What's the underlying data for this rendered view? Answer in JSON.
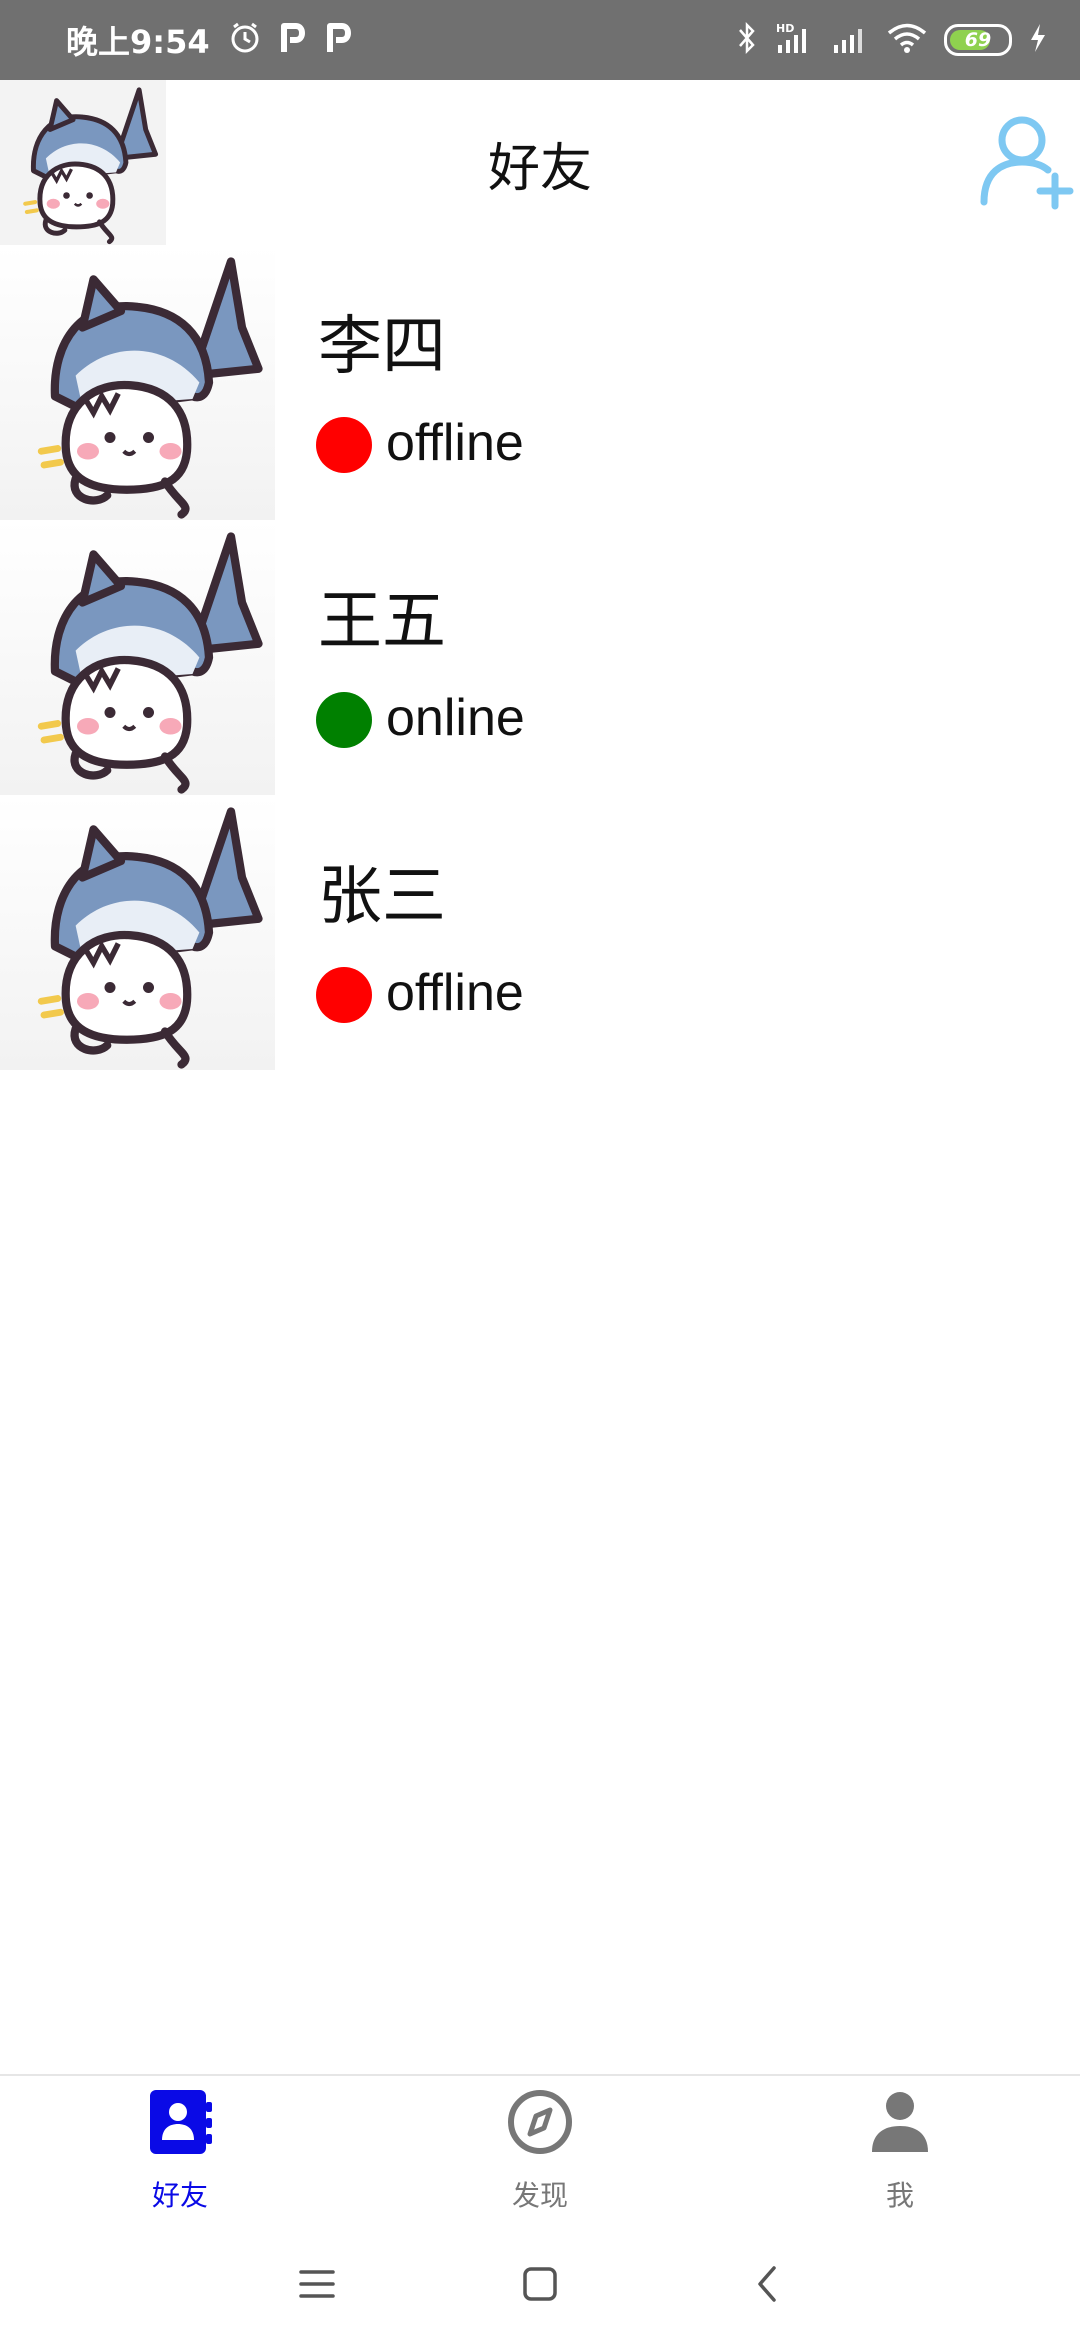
{
  "status_bar": {
    "time": "晚上9:54",
    "battery": "69",
    "icons": [
      "alarm-icon",
      "p-app-icon",
      "p-app-icon",
      "bluetooth-icon",
      "hd-signal-icon",
      "signal-icon",
      "wifi-icon",
      "battery-icon",
      "charging-icon"
    ]
  },
  "header": {
    "title": "好友",
    "add_friend_icon": "add-user-icon",
    "accent_color": "#7ec8f2"
  },
  "friends": [
    {
      "name": "李四",
      "status": "offline",
      "status_color": "#ff0000"
    },
    {
      "name": "王五",
      "status": "online",
      "status_color": "#008000"
    },
    {
      "name": "张三",
      "status": "offline",
      "status_color": "#ff0000"
    }
  ],
  "bottom_nav": {
    "active_color": "#0a0ae6",
    "inactive_color": "#777777",
    "items": [
      {
        "label": "好友",
        "icon": "contacts-icon",
        "active": true
      },
      {
        "label": "发现",
        "icon": "compass-icon",
        "active": false
      },
      {
        "label": "我",
        "icon": "person-icon",
        "active": false
      }
    ]
  },
  "system_nav": {
    "icons": [
      "menu-icon",
      "home-icon",
      "back-icon"
    ]
  }
}
